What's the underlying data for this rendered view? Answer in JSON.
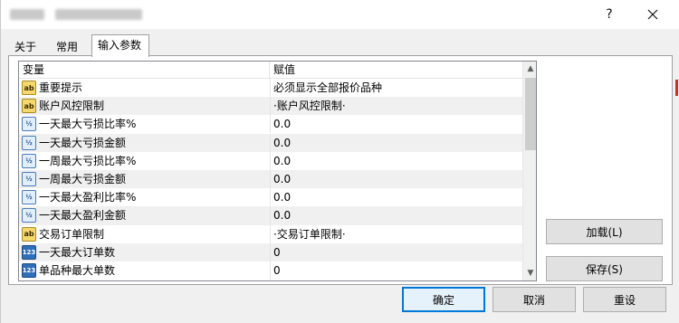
{
  "titlebar": {
    "help_label": "?",
    "close_icon": "close-icon"
  },
  "tabs": [
    {
      "label": "关于",
      "active": false
    },
    {
      "label": "常用",
      "active": false
    },
    {
      "label": "输入参数",
      "active": true
    }
  ],
  "table": {
    "headers": [
      "变量",
      "赋值"
    ],
    "rows": [
      {
        "icon": "ab",
        "name": "重要提示",
        "value": "必须显示全部报价品种"
      },
      {
        "icon": "ab",
        "name": "账户风控限制",
        "value": "·账户风控限制·"
      },
      {
        "icon": "frac",
        "name": "一天最大亏损比率%",
        "value": "0.0"
      },
      {
        "icon": "frac",
        "name": "一天最大亏损金额",
        "value": "0.0"
      },
      {
        "icon": "frac",
        "name": "一周最大亏损比率%",
        "value": "0.0"
      },
      {
        "icon": "frac",
        "name": "一周最大亏损金额",
        "value": "0.0"
      },
      {
        "icon": "frac",
        "name": "一天最大盈利比率%",
        "value": "0.0"
      },
      {
        "icon": "frac",
        "name": "一天最大盈利金额",
        "value": "0.0"
      },
      {
        "icon": "ab",
        "name": "交易订单限制",
        "value": "·交易订单限制·"
      },
      {
        "icon": "num",
        "name": "一天最大订单数",
        "value": "0"
      },
      {
        "icon": "num",
        "name": "单品种最大单数",
        "value": "0"
      }
    ]
  },
  "icon_text": {
    "ab": "ab",
    "frac": "½",
    "num": "123"
  },
  "buttons": {
    "load": "加载(L)",
    "save": "保存(S)",
    "ok": "确定",
    "cancel": "取消",
    "reset": "重设"
  },
  "colors": {
    "accent": "#0078d7",
    "alt_row": "#f0f0f0"
  }
}
